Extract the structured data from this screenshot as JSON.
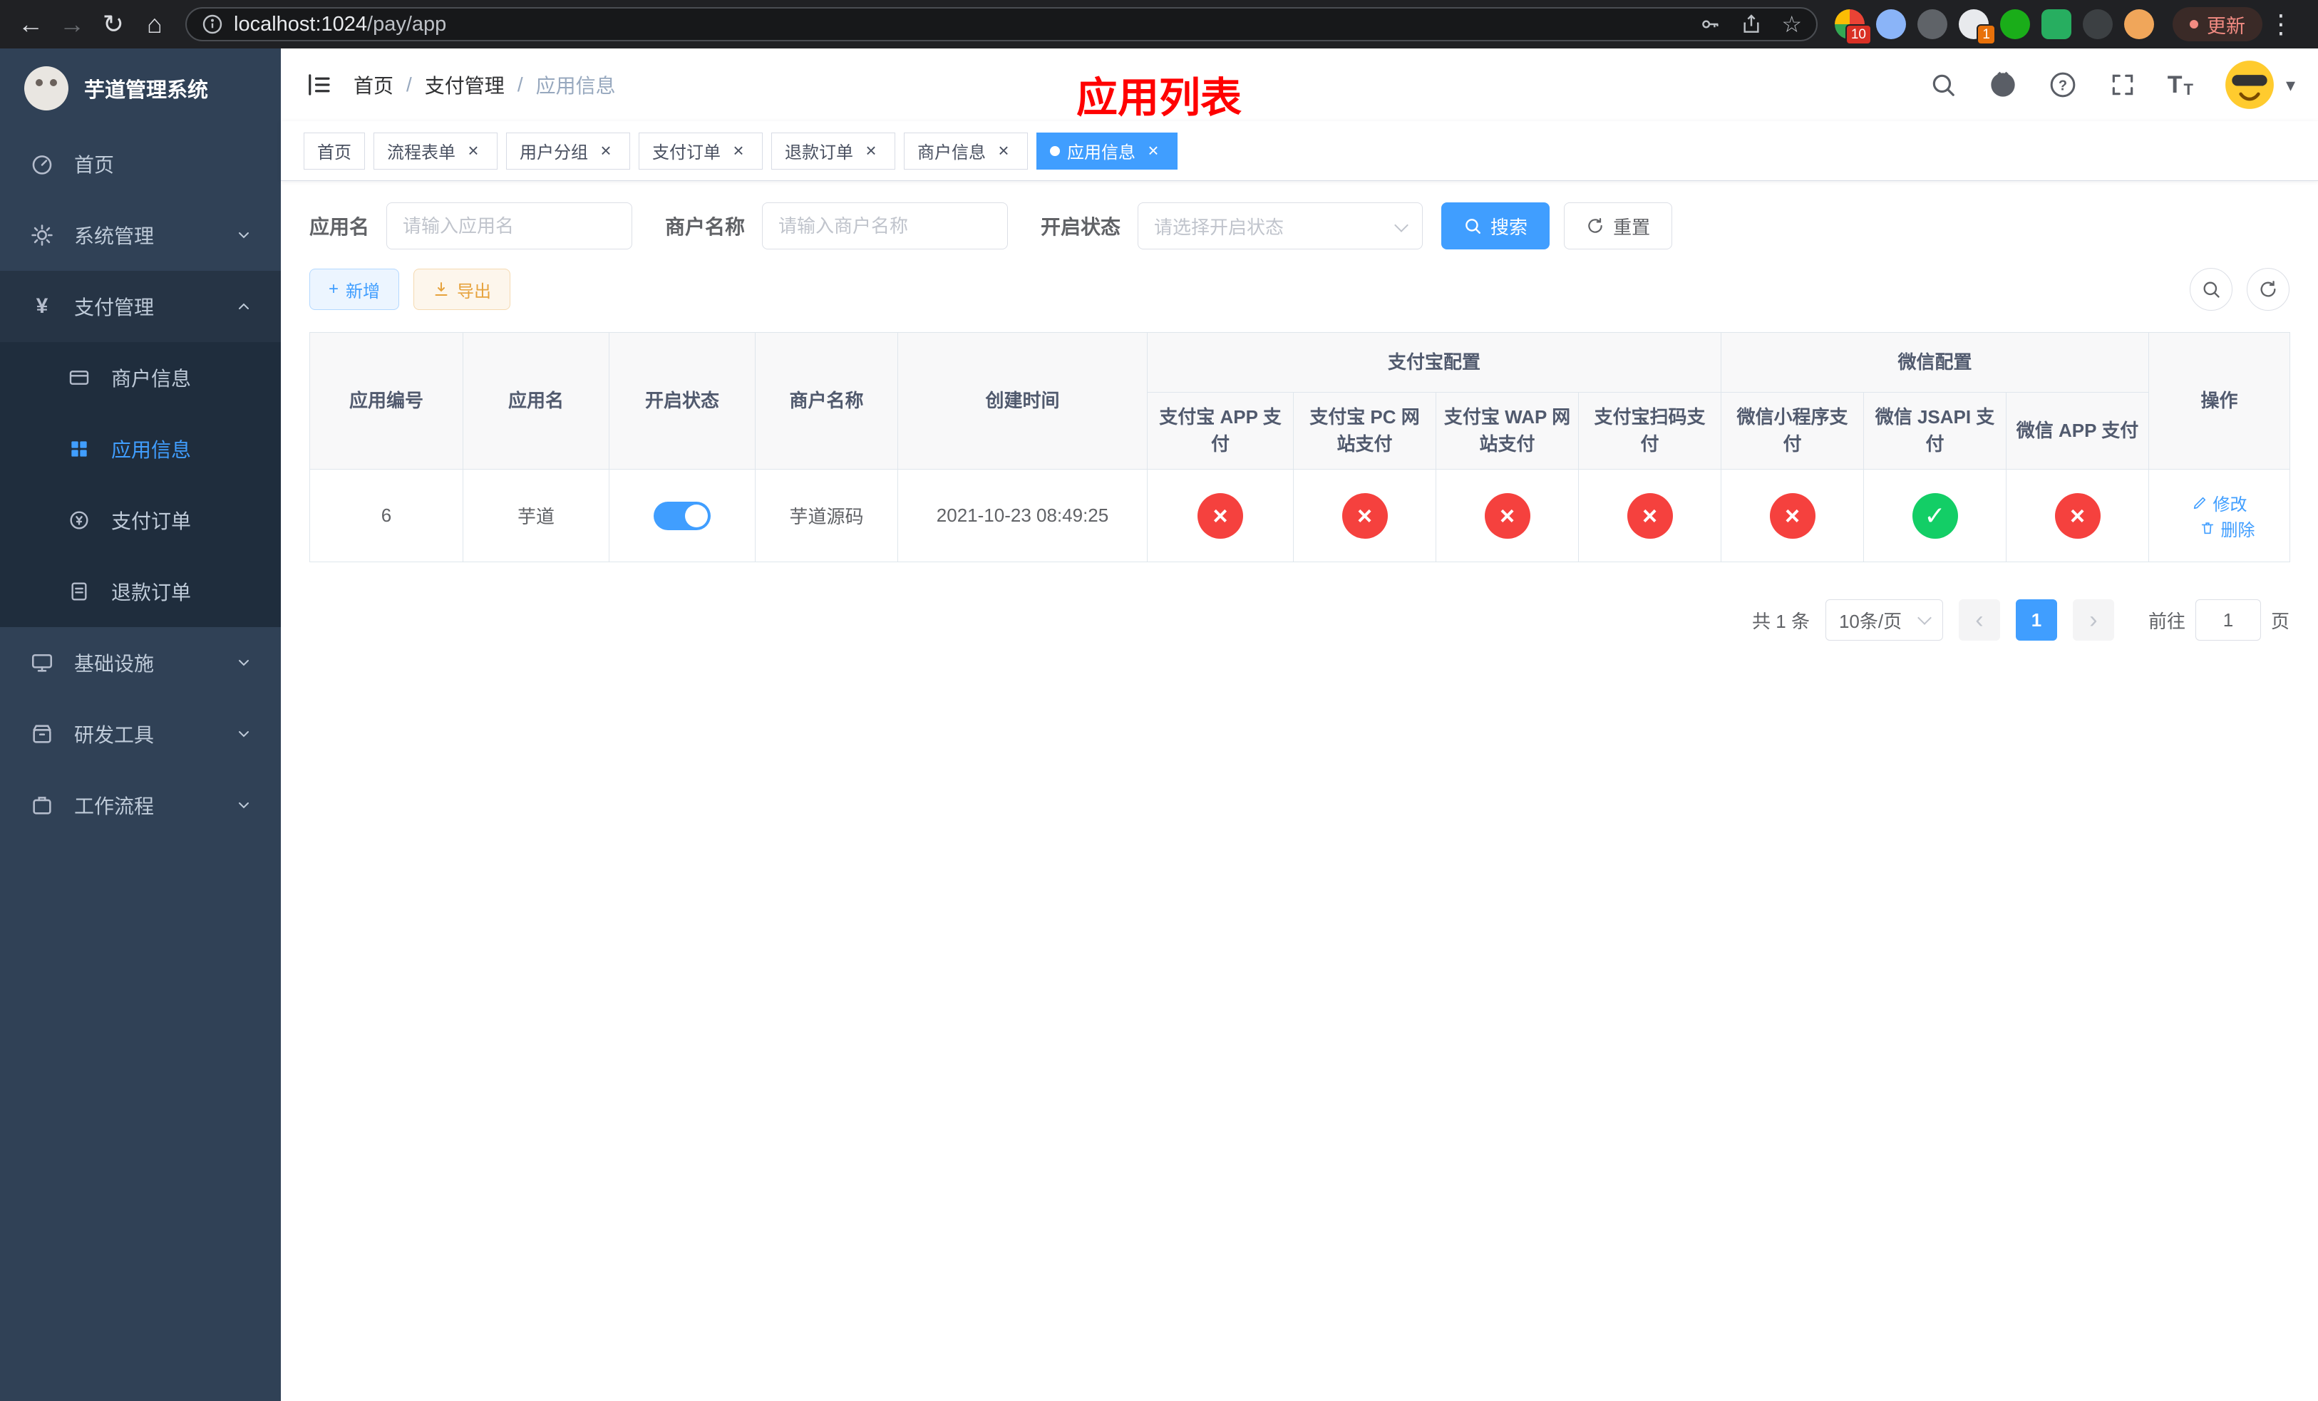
{
  "icons": {
    "back": "←",
    "forward": "→",
    "reload": "↻",
    "home": "⌂",
    "star": "☆",
    "browser_menu": "⋮",
    "close": "×",
    "caret_down": "▾",
    "prev": "‹",
    "next": "›",
    "plus": "+",
    "yen": "¥",
    "question": "?",
    "check": "✓",
    "cross": "×",
    "fontsize_big": "T",
    "fontsize_small": "T"
  },
  "browser": {
    "url_host": "localhost:1024",
    "url_path": "/pay/app",
    "update_label": "更新",
    "extension_badge_1": "10",
    "extension_badge_2": "1"
  },
  "sidebar": {
    "title": "芋道管理系统",
    "items": {
      "home": "首页",
      "system": "系统管理",
      "payment": "支付管理",
      "merchant": "商户信息",
      "app": "应用信息",
      "pay_order": "支付订单",
      "refund_order": "退款订单",
      "infra": "基础设施",
      "dev_tools": "研发工具",
      "workflow": "工作流程"
    }
  },
  "breadcrumb": [
    "首页",
    "支付管理",
    "应用信息"
  ],
  "overlay_title": "应用列表",
  "tabs": [
    {
      "label": "首页"
    },
    {
      "label": "流程表单"
    },
    {
      "label": "用户分组"
    },
    {
      "label": "支付订单"
    },
    {
      "label": "退款订单"
    },
    {
      "label": "商户信息"
    },
    {
      "label": "应用信息"
    }
  ],
  "filters": {
    "app_name_label": "应用名",
    "app_name_placeholder": "请输入应用名",
    "merchant_label": "商户名称",
    "merchant_placeholder": "请输入商户名称",
    "status_label": "开启状态",
    "status_placeholder": "请选择开启状态",
    "search_label": "搜索",
    "reset_label": "重置"
  },
  "toolbar": {
    "add_label": "新增",
    "export_label": "导出"
  },
  "table": {
    "group_alipay": "支付宝配置",
    "group_wechat": "微信配置",
    "columns": [
      "应用编号",
      "应用名",
      "开启状态",
      "商户名称",
      "创建时间",
      "支付宝 APP 支付",
      "支付宝 PC 网站支付",
      "支付宝 WAP 网站支付",
      "支付宝扫码支付",
      "微信小程序支付",
      "微信 JSAPI 支付",
      "微信 APP 支付",
      "操作"
    ],
    "rows": [
      {
        "id": "6",
        "name": "芋道",
        "status": "on",
        "merchant": "芋道源码",
        "created_at": "2021-10-23 08:49:25",
        "configs": [
          "no",
          "no",
          "no",
          "no",
          "no",
          "yes",
          "no"
        ],
        "edit_label": "修改",
        "delete_label": "删除"
      }
    ]
  },
  "pagination": {
    "total": "共 1 条",
    "page_size": "10条/页",
    "page": "1",
    "goto_label": "前往",
    "goto_value": "1",
    "goto_suffix": "页"
  },
  "colors": {
    "primary": "#409eff",
    "success": "#13ce66",
    "danger": "#f5413e",
    "warning": "#e6a23c",
    "sidebar_bg": "#304156",
    "sidebar_sub_bg": "#1f2d3d",
    "overlay_title": "#ff0000"
  }
}
